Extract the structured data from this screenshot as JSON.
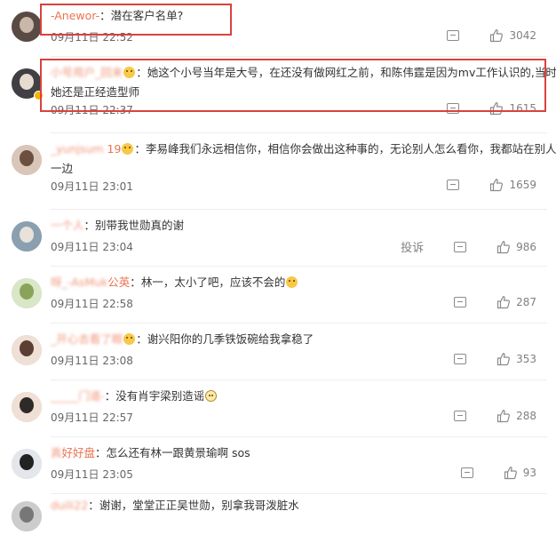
{
  "comments": [
    {
      "user": "-Anewor-",
      "blurred": false,
      "sep": "：",
      "text": "潜在客户名单?",
      "time": "09月11日 22:52",
      "likes": "3042",
      "report": "",
      "emoji": ""
    },
    {
      "user": "小号用户_回来",
      "blurred": true,
      "sep": "：",
      "text": "她这个小号当年是大号，在还没有做网红之前，和陈伟霆是因为mv工作认识的,当时",
      "text2": "她还是正经造型师",
      "time": "09月11日 22:37",
      "likes": "1615",
      "report": "",
      "emoji": "smile"
    },
    {
      "user": "_yunjsum",
      "blurred": true,
      "suffix": " 19",
      "sep": "：",
      "text": "李易峰我们永远相信你，相信你会做出这种事的，无论别人怎么看你，我都站在别人那",
      "text2": "一边",
      "time": "09月11日 23:01",
      "likes": "1659",
      "report": "",
      "emoji": "smile"
    },
    {
      "user": "一个人",
      "blurred": true,
      "sep": "：",
      "text": "别带我世勋真的谢",
      "time": "09月11日 23:04",
      "likes": "986",
      "report": "投诉",
      "emoji": ""
    },
    {
      "user": "呀_-AsMuk",
      "blurred": true,
      "suffix": "公英",
      "sep": "：",
      "text": "林一，太小了吧，应该不会的",
      "time": "09月11日 22:58",
      "likes": "287",
      "report": "",
      "emoji": "end-laugh"
    },
    {
      "user": "_开心去看了眼",
      "blurred": true,
      "sep": "：",
      "text": "谢兴阳你的几季铁饭碗给我拿稳了",
      "time": "09月11日 23:08",
      "likes": "353",
      "report": "",
      "emoji": "smile"
    },
    {
      "user": "_____门道-",
      "blurred": true,
      "sep": "：",
      "text": "没有肖宇梁别造谣",
      "time": "09月11日 22:57",
      "likes": "288",
      "report": "",
      "emoji": "end-glasses"
    },
    {
      "user": "真",
      "blurred": true,
      "suffix": "好好盘",
      "sep": "：",
      "text": "怎么还有林一跟黄景瑜啊 sos",
      "time": "09月11日 23:05",
      "likes": "93",
      "report": "",
      "emoji": ""
    },
    {
      "user": "duili22",
      "blurred": true,
      "sep": "：",
      "text": "谢谢，堂堂正正吴世勋，别拿我哥泼脏水",
      "time": "",
      "likes": "",
      "report": "",
      "emoji": ""
    }
  ],
  "colors": {
    "username": "#eb7350",
    "highlight": "#d9423f"
  },
  "icons": {
    "reply": "comment-icon",
    "like": "thumbs-up-icon",
    "emoji": "emoji-icon"
  }
}
